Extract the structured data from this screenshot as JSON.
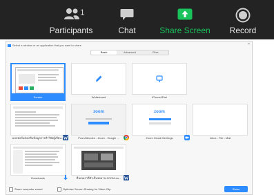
{
  "toolbar": {
    "participants": {
      "label": "Participants",
      "count": "1",
      "icon": "participants-icon"
    },
    "chat": {
      "label": "Chat",
      "icon": "chat-icon"
    },
    "share_screen": {
      "label": "Share Screen",
      "icon": "share-screen-icon",
      "color": "#19c25b"
    },
    "record": {
      "label": "Record",
      "icon": "record-icon"
    }
  },
  "dialog": {
    "title": "Select a window or an application that you want to share",
    "close": "×",
    "tabs": [
      {
        "label": "Basic",
        "active": true
      },
      {
        "label": "Advanced",
        "active": false
      },
      {
        "label": "Files",
        "active": false
      }
    ],
    "tiles": [
      {
        "caption": "Screen",
        "selected": true
      },
      {
        "caption": "Whiteboard"
      },
      {
        "caption": "iPhone/iPad"
      },
      {
        "caption": "แบบฟอร์มส่งเสริมข้อมูลการทำวิจัยผู้เขียน..."
      },
      {
        "caption": "Post Attendee - Zoom - Google ..."
      },
      {
        "caption": "Zoom Cloud Meetings"
      },
      {
        "caption": "Inbox - File - Mail"
      },
      {
        "caption": "Downloads"
      },
      {
        "caption": "ที่นอนเราที่ทำเป็นจอมาน ZOOM.do..."
      }
    ],
    "thumb_texts": {
      "zoom_logo": "zoom"
    },
    "footer": {
      "share_sound": "Share computer sound",
      "optimize": "Optimize Screen Sharing for Video Clip",
      "share_button": "Share"
    }
  },
  "colors": {
    "toolbar_bg": "#232323",
    "accent": "#2d8cff",
    "share_green": "#19c25b"
  }
}
